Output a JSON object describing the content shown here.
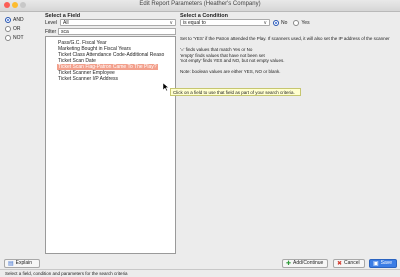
{
  "window": {
    "title": "Edit Report Parameters (Heather's Company)"
  },
  "connectors": [
    {
      "label": "AND",
      "selected": true
    },
    {
      "label": "OR",
      "selected": false
    },
    {
      "label": "NOT",
      "selected": false
    }
  ],
  "field_panel": {
    "header": "Select a Field",
    "level_label": "Level",
    "level_value": "All",
    "filter_label": "Filter",
    "filter_value": "sca",
    "items": [
      "Pass/G.C. Fiscal Year",
      "Marketing Bought in Fiscal Years",
      "Ticket Class Attendance Code-Additional Reaso",
      "Ticket Scan Date",
      "Ticket Scan Flag-Patron Came To The Play?",
      "Ticket Scanner Employee",
      "Ticket Scanner I/P Address"
    ],
    "selected_index": 4
  },
  "tooltip": "Click on a field to use that field as part of your search criteria.",
  "condition_panel": {
    "header": "Select a Condition",
    "condition_value": "is equal to",
    "no_label": "No",
    "yes_label": "Yes",
    "selected": "No",
    "description": [
      "Set to 'YES' if the Patron attended the Play.  If scanners used, it will also set the IP address of the scanner",
      "",
      "'=' finds values that match Yes or No",
      "'empty' finds values that have not been set",
      "'not empty' finds YES and NO, but not empty values.",
      "",
      "Note: boolean values are either YES, NO or blank."
    ]
  },
  "buttons": {
    "explain": "Explain",
    "add_continue": "Add/Continue",
    "cancel": "Cancel",
    "save": "Save"
  },
  "status": "Select a field, condition and parameters for the search criteria",
  "colors": {
    "selection": "#f3a08c",
    "primary": "#3b7de5",
    "tooltip": "#ffffcf"
  }
}
